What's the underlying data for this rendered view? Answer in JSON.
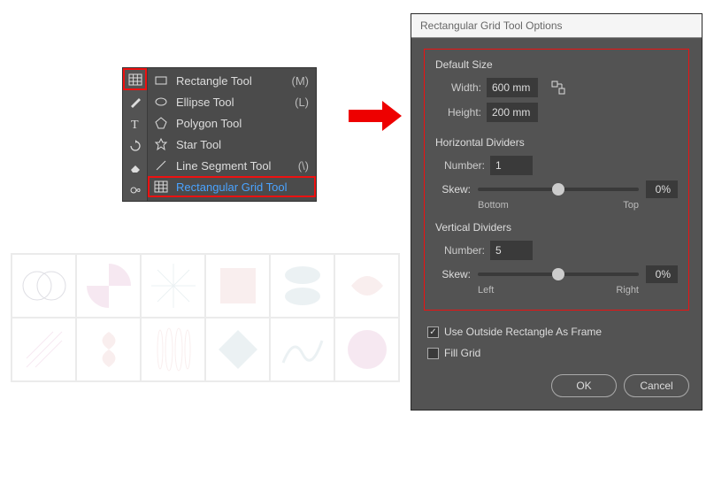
{
  "tool_menu": {
    "items": [
      {
        "label": "Rectangle Tool",
        "shortcut": "(M)"
      },
      {
        "label": "Ellipse Tool",
        "shortcut": "(L)"
      },
      {
        "label": "Polygon Tool",
        "shortcut": ""
      },
      {
        "label": "Star Tool",
        "shortcut": ""
      },
      {
        "label": "Line Segment Tool",
        "shortcut": "(\\)"
      },
      {
        "label": "Rectangular Grid Tool",
        "shortcut": ""
      }
    ]
  },
  "dialog": {
    "title": "Rectangular Grid Tool Options",
    "default_size": {
      "title": "Default Size",
      "width_label": "Width:",
      "width_value": "600 mm",
      "height_label": "Height:",
      "height_value": "200 mm"
    },
    "h_div": {
      "title": "Horizontal Dividers",
      "number_label": "Number:",
      "number_value": "1",
      "skew_label": "Skew:",
      "skew_value": "0%",
      "low": "Bottom",
      "high": "Top"
    },
    "v_div": {
      "title": "Vertical Dividers",
      "number_label": "Number:",
      "number_value": "5",
      "skew_label": "Skew:",
      "skew_value": "0%",
      "low": "Left",
      "high": "Right"
    },
    "checks": {
      "outside_label": "Use Outside Rectangle As Frame",
      "fill_label": "Fill Grid"
    },
    "buttons": {
      "ok": "OK",
      "cancel": "Cancel"
    }
  }
}
